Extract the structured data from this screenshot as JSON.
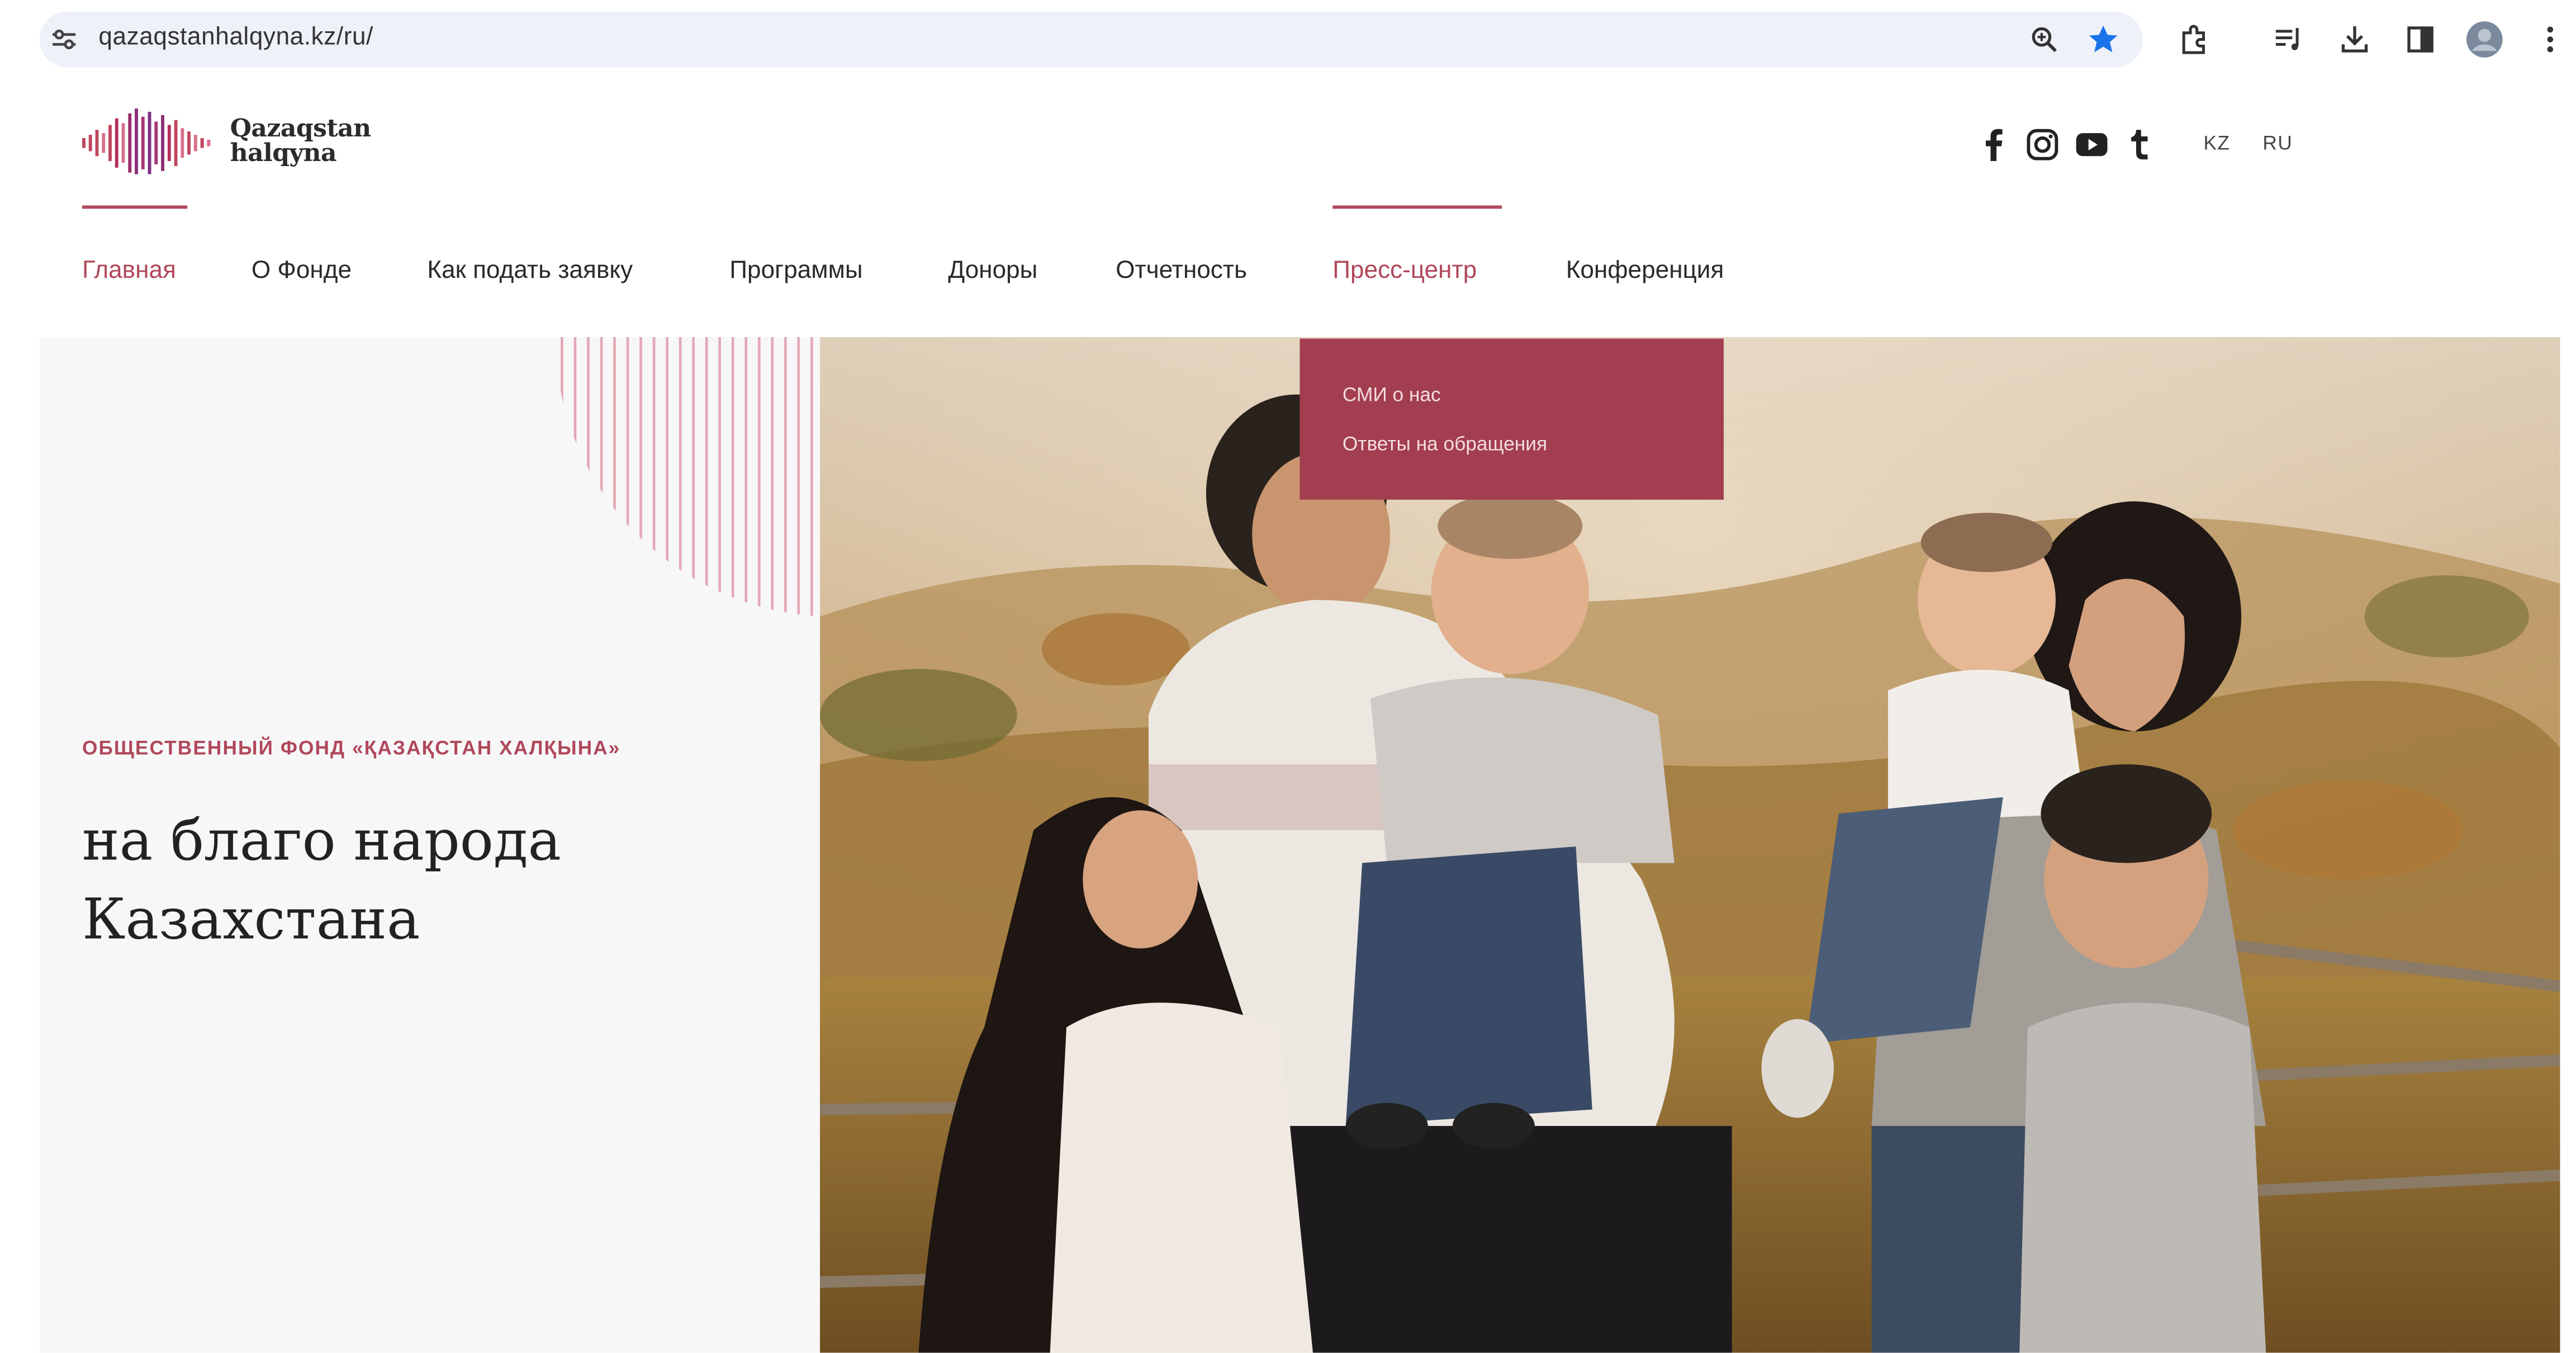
{
  "browser": {
    "url": "qazaqstanhalqyna.kz/ru/"
  },
  "logo": {
    "line1": "Qazaqstan",
    "line2": "halqyna"
  },
  "social": [
    "facebook-icon",
    "instagram-icon",
    "youtube-icon",
    "tumblr-icon"
  ],
  "languages": [
    "KZ",
    "RU"
  ],
  "nav": {
    "items": [
      {
        "label": "Главная"
      },
      {
        "label": "О Фонде"
      },
      {
        "label": "Как подать заявку"
      },
      {
        "label": "Программы"
      },
      {
        "label": "Доноры"
      },
      {
        "label": "Отчетность"
      },
      {
        "label": "Пресс-центр"
      },
      {
        "label": "Конференция"
      }
    ]
  },
  "dropdown": {
    "items": [
      {
        "label": "СМИ о нас"
      },
      {
        "label": "Ответы на обращения"
      }
    ]
  },
  "hero": {
    "eyebrow": "ОБЩЕСТВЕННЫЙ ФОНД «ҚАЗАҚСТАН ХАЛҚЫНА»",
    "title_line1": "на благо народа",
    "title_line2": "Казахстана"
  },
  "colors": {
    "accent": "#b0485a",
    "dropdown_bg": "#a23e4f",
    "star": "#1a73e8"
  }
}
